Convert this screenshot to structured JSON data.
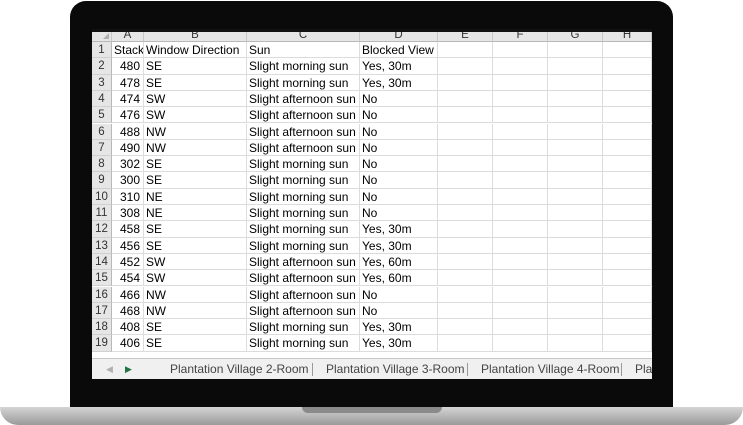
{
  "columns": [
    "A",
    "B",
    "C",
    "D",
    "E",
    "F",
    "G",
    "H"
  ],
  "rows": [
    {
      "n": "1",
      "a": "Stack",
      "b": "Window Direction",
      "c": "Sun",
      "d": "Blocked View"
    },
    {
      "n": "2",
      "a": "480",
      "b": "SE",
      "c": "Slight morning sun",
      "d": "Yes, 30m"
    },
    {
      "n": "3",
      "a": "478",
      "b": "SE",
      "c": "Slight morning sun",
      "d": "Yes, 30m"
    },
    {
      "n": "4",
      "a": "474",
      "b": "SW",
      "c": "Slight afternoon sun",
      "d": "No"
    },
    {
      "n": "5",
      "a": "476",
      "b": "SW",
      "c": "Slight afternoon sun",
      "d": "No"
    },
    {
      "n": "6",
      "a": "488",
      "b": "NW",
      "c": "Slight afternoon sun",
      "d": "No"
    },
    {
      "n": "7",
      "a": "490",
      "b": "NW",
      "c": "Slight afternoon sun",
      "d": "No"
    },
    {
      "n": "8",
      "a": "302",
      "b": "SE",
      "c": "Slight morning sun",
      "d": "No"
    },
    {
      "n": "9",
      "a": "300",
      "b": "SE",
      "c": "Slight morning sun",
      "d": "No"
    },
    {
      "n": "10",
      "a": "310",
      "b": "NE",
      "c": "Slight morning sun",
      "d": "No"
    },
    {
      "n": "11",
      "a": "308",
      "b": "NE",
      "c": "Slight morning sun",
      "d": "No"
    },
    {
      "n": "12",
      "a": "458",
      "b": "SE",
      "c": "Slight morning sun",
      "d": "Yes, 30m"
    },
    {
      "n": "13",
      "a": "456",
      "b": "SE",
      "c": "Slight morning sun",
      "d": "Yes, 30m"
    },
    {
      "n": "14",
      "a": "452",
      "b": "SW",
      "c": "Slight afternoon sun",
      "d": "Yes, 60m"
    },
    {
      "n": "15",
      "a": "454",
      "b": "SW",
      "c": "Slight afternoon sun",
      "d": "Yes, 60m"
    },
    {
      "n": "16",
      "a": "466",
      "b": "NW",
      "c": "Slight afternoon sun",
      "d": "No"
    },
    {
      "n": "17",
      "a": "468",
      "b": "NW",
      "c": "Slight afternoon sun",
      "d": "No"
    },
    {
      "n": "18",
      "a": "408",
      "b": "SE",
      "c": "Slight morning sun",
      "d": "Yes, 30m"
    },
    {
      "n": "19",
      "a": "406",
      "b": "SE",
      "c": "Slight morning sun",
      "d": "Yes, 30m"
    }
  ],
  "sheet_tabs": [
    "Plantation Village 2-Room",
    "Plantation Village 3-Room",
    "Plantation Village 4-Room",
    "Pla"
  ],
  "nav": {
    "prev_icon": "triangle-left-icon",
    "next_icon": "triangle-right-icon",
    "next_color": "#217346"
  }
}
